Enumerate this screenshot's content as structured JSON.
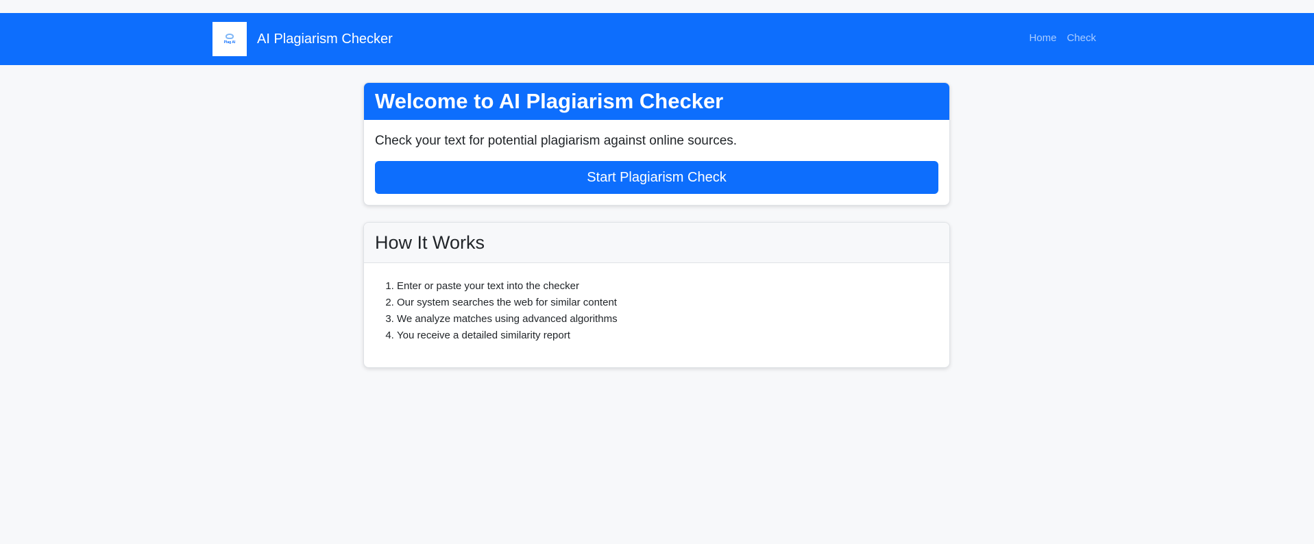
{
  "navbar": {
    "logo_text": "Plag AI",
    "brand": "AI Plagiarism Checker",
    "links": [
      {
        "label": "Home"
      },
      {
        "label": "Check"
      }
    ]
  },
  "welcome_card": {
    "title": "Welcome to AI Plagiarism Checker",
    "description": "Check your text for potential plagiarism against online sources.",
    "button_label": "Start Plagiarism Check"
  },
  "how_it_works": {
    "title": "How It Works",
    "steps": [
      "Enter or paste your text into the checker",
      "Our system searches the web for similar content",
      "We analyze matches using advanced algorithms",
      "You receive a detailed similarity report"
    ]
  },
  "colors": {
    "primary": "#0d6efd",
    "background": "#f7f8fa"
  }
}
